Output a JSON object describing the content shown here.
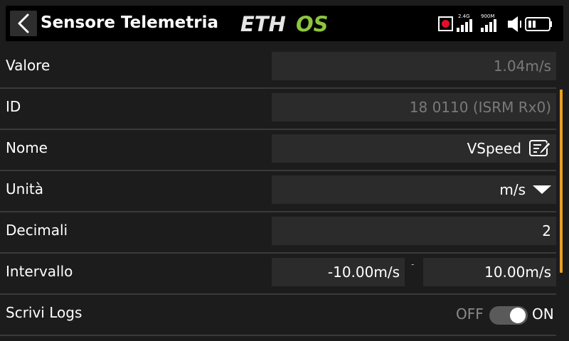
{
  "header": {
    "title": "Sensore Telemetria",
    "logo": {
      "left": "ETH",
      "right": "OS",
      "color_left": "#e6e6e6",
      "color_right": "#8cc63f"
    },
    "status": {
      "band_24": "2.4G",
      "band_900": "900M"
    }
  },
  "rows": [
    {
      "label": "Valore",
      "value": "1.04m/s"
    },
    {
      "label": "ID",
      "value": "18 0110 (ISRM Rx0)"
    },
    {
      "label": "Nome",
      "value": "VSpeed"
    },
    {
      "label": "Unità",
      "value": "m/s"
    },
    {
      "label": "Decimali",
      "value": "2"
    },
    {
      "label": "Intervallo",
      "min": "-10.00m/s",
      "separator": "-",
      "max": "10.00m/s"
    },
    {
      "label": "Scrivi Logs",
      "off": "OFF",
      "on": "ON",
      "state": "on"
    }
  ],
  "colors": {
    "accent": "#e8a020",
    "record": "#e0102a",
    "field": "#2b2b2b",
    "divider": "#3a3a3a"
  }
}
